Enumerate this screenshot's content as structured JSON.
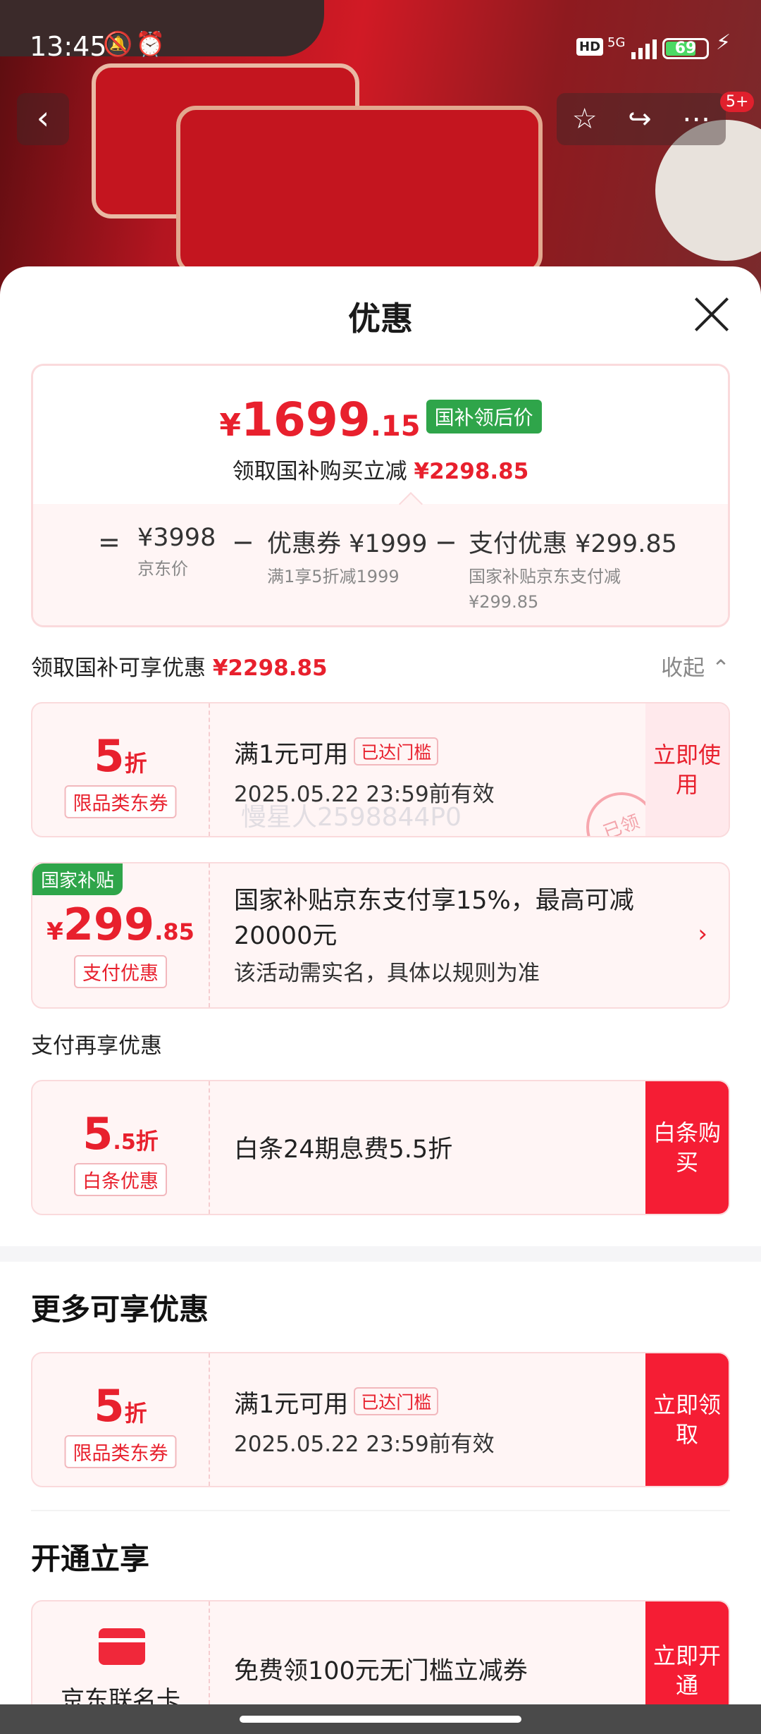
{
  "status_bar": {
    "time": "13:45",
    "hd": "HD",
    "network": "5G",
    "battery": "69"
  },
  "top_nav": {
    "badge": "5+"
  },
  "sheet": {
    "title": "优惠"
  },
  "summary": {
    "yen": "¥",
    "price_int": "1699",
    "price_dec": ".15",
    "price_tag": "国补领后价",
    "reduce_text": "领取国补购买立减",
    "reduce_amount": "¥2298.85",
    "eq": "=",
    "minus": "−",
    "items": [
      {
        "value": "¥3998",
        "label": "京东价"
      },
      {
        "value": "优惠券 ¥1999",
        "label": "满1享5折减1999"
      },
      {
        "value": "支付优惠 ¥299.85",
        "label": "国家补贴京东支付减¥299.85"
      }
    ]
  },
  "section1": {
    "label": "领取国补可享优惠",
    "amount": "¥2298.85",
    "collapse": "收起"
  },
  "coupon1": {
    "disc_num": "5",
    "disc_unit": "折",
    "tag": "限品类东券",
    "line1": "满1元可用",
    "pill": "已达门槛",
    "line2": "2025.05.22 23:59前有效",
    "button": "立即使用",
    "stamp": "已领",
    "watermark": "慢星人2598844P0"
  },
  "gov": {
    "flag": "国家补贴",
    "yen": "¥",
    "num": "299",
    "dec": ".85",
    "tag": "支付优惠",
    "line1": "国家补贴京东支付享15%，最高可减20000元",
    "line2": "该活动需实名，具体以规则为准",
    "chevron": "›"
  },
  "section2": {
    "label": "支付再享优惠"
  },
  "baitiao": {
    "disc_num": "5",
    "disc_sub": ".5",
    "disc_unit": "折",
    "tag": "白条优惠",
    "line1": "白条24期息费5.5折",
    "button": "白条购买"
  },
  "more": {
    "title": "更多可享优惠",
    "disc_num": "5",
    "disc_unit": "折",
    "tag": "限品类东券",
    "line1": "满1元可用",
    "pill": "已达门槛",
    "line2": "2025.05.22 23:59前有效",
    "button": "立即领取"
  },
  "open": {
    "title": "开通立享",
    "card_name": "京东联名卡",
    "line1": "免费领100元无门槛立减券",
    "button": "立即开通"
  }
}
